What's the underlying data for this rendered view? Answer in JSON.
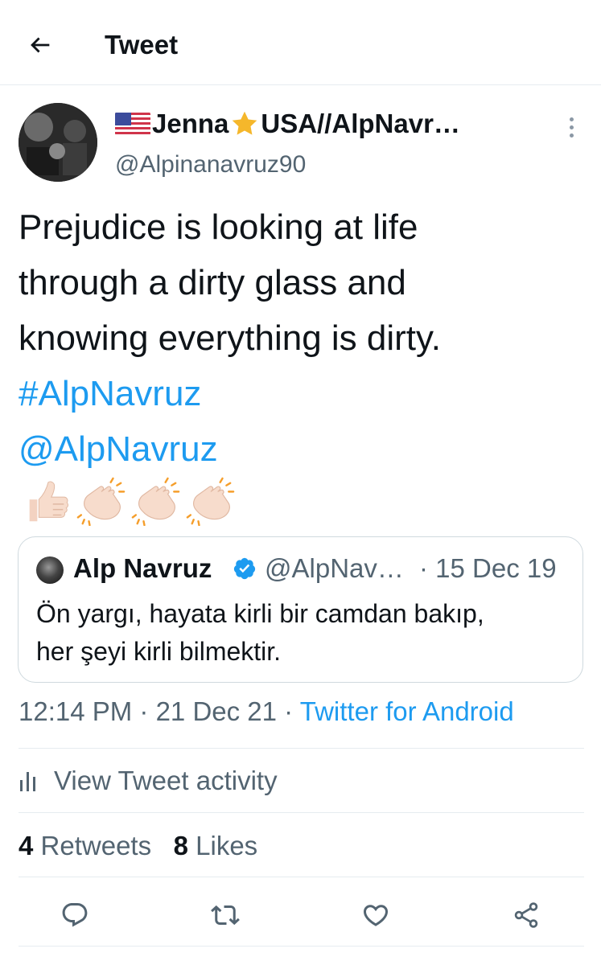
{
  "header": {
    "title": "Tweet",
    "back_icon": "arrow-left-icon"
  },
  "author": {
    "display_name_prefix": "Jenna",
    "display_name_suffix": "USA//AlpNavr…",
    "handle": "@Alpinanavruz90"
  },
  "tweet": {
    "lines": [
      "Prejudice is looking at life",
      "through a dirty glass and",
      "knowing everything is dirty."
    ],
    "hashtag": "#AlpNavruz",
    "mention": "@AlpNavruz",
    "emojis": [
      "thumbs-up-icon",
      "clapping-hands-icon",
      "clapping-hands-icon",
      "clapping-hands-icon"
    ]
  },
  "quote": {
    "name": "Alp Navruz",
    "handle": "@AlpNav…",
    "date": "· 15 Dec 19",
    "lines": [
      "Ön yargı, hayata kirli bir camdan bakıp,",
      "her şeyi kirli bilmektir."
    ]
  },
  "meta": {
    "time": "12:14 PM",
    "sep1": " · ",
    "date": "21 Dec 21",
    "sep2": " · ",
    "source": "Twitter for Android"
  },
  "activity": {
    "label": "View Tweet activity"
  },
  "stats": {
    "retweets_count": "4",
    "retweets_label": "Retweets",
    "likes_count": "8",
    "likes_label": "Likes"
  },
  "colors": {
    "accent": "#1d9bf0",
    "secondary_text": "#536471",
    "border": "#cfd9de"
  }
}
